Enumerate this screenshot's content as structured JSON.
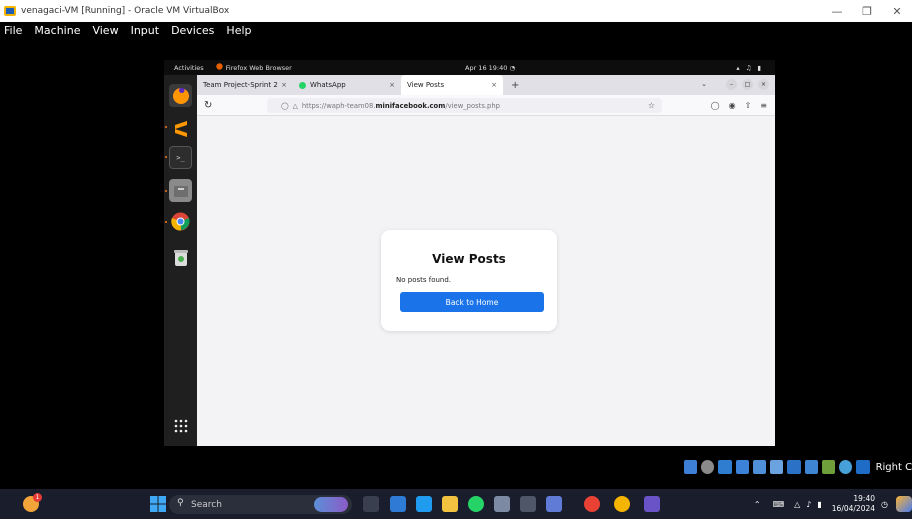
{
  "host": {
    "title": "venagaci-VM [Running] - Oracle VM VirtualBox",
    "menu": [
      "File",
      "Machine",
      "View",
      "Input",
      "Devices",
      "Help"
    ],
    "right_ctrl_label": "Right C"
  },
  "gnome": {
    "activities": "Activities",
    "app_name": "Firefox Web Browser",
    "clock": "Apr 16  19:40"
  },
  "browser": {
    "tabs": [
      {
        "label": "Team Project-Sprint 2",
        "active": false
      },
      {
        "label": "WhatsApp",
        "active": false
      },
      {
        "label": "View Posts",
        "active": true
      }
    ],
    "url_prefix": "https://waph-team08.",
    "url_domain": "minifacebook.com",
    "url_suffix": "/view_posts.php"
  },
  "page": {
    "heading": "View Posts",
    "message": "No posts found.",
    "back_button": "Back to Home"
  },
  "taskbar": {
    "search_placeholder": "Search",
    "time": "19:40",
    "date": "16/04/2024"
  },
  "colors": {
    "accent": "#1a73e8",
    "dock_bg": "#1f1f1f"
  }
}
